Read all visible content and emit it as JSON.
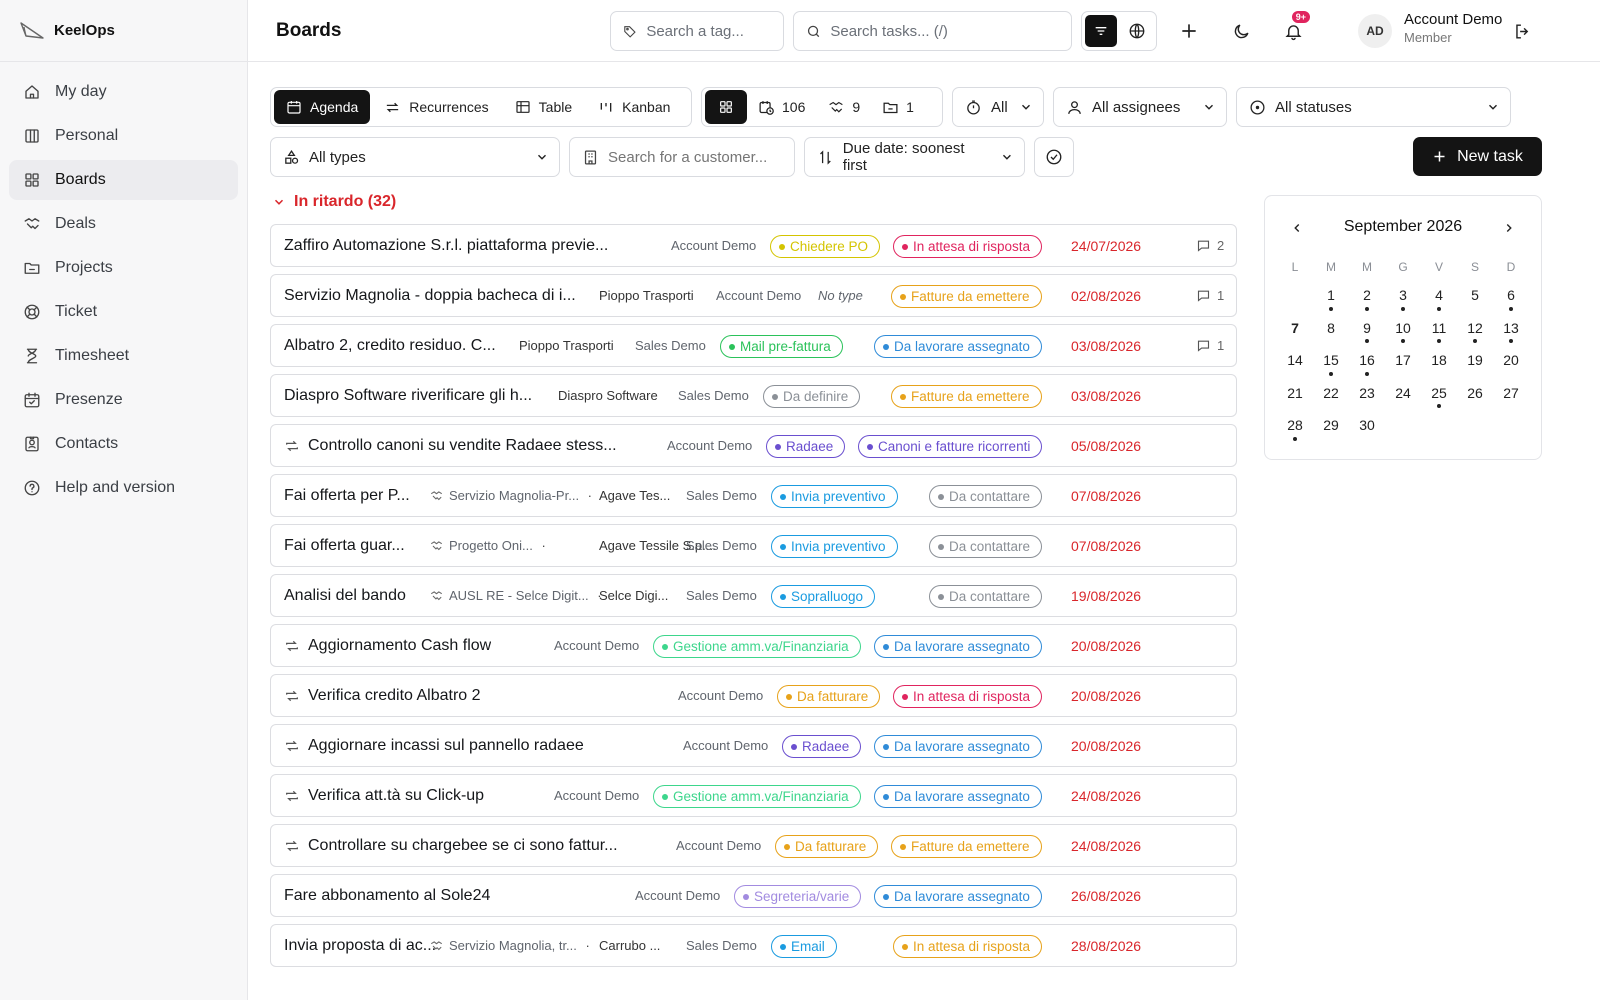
{
  "app": {
    "name": "KeelOps"
  },
  "sidebar": {
    "items": [
      {
        "label": "My day",
        "icon": "home-icon"
      },
      {
        "label": "Personal",
        "icon": "board-icon"
      },
      {
        "label": "Boards",
        "icon": "grid-icon",
        "active": true
      },
      {
        "label": "Deals",
        "icon": "handshake-icon"
      },
      {
        "label": "Projects",
        "icon": "folder-icon"
      },
      {
        "label": "Ticket",
        "icon": "lifebuoy-icon"
      },
      {
        "label": "Timesheet",
        "icon": "hourglass-icon"
      },
      {
        "label": "Presenze",
        "icon": "calendar-check-icon"
      },
      {
        "label": "Contacts",
        "icon": "contact-card-icon"
      },
      {
        "label": "Help and version",
        "icon": "help-circle-icon"
      }
    ]
  },
  "header": {
    "title": "Boards",
    "tag_search_placeholder": "Search a tag...",
    "task_search_placeholder": "Search tasks... (/)",
    "notif_badge": "9+",
    "avatar_initials": "AD",
    "user_name": "Account Demo",
    "user_role": "Member"
  },
  "toolbar": {
    "views": [
      "Agenda",
      "Recurrences",
      "Table",
      "Kanban"
    ],
    "active_view": "Agenda",
    "counts": {
      "tasks": "106",
      "projects": "9",
      "folders": "1"
    },
    "time_filter": "All",
    "assignees_filter": "All assignees",
    "status_filter": "All statuses",
    "types_filter": "All types",
    "customer_search_placeholder": "Search for a customer...",
    "sort": "Due date: soonest first",
    "new_task": "New task"
  },
  "section": {
    "title": "In ritardo (32)"
  },
  "colors": {
    "yellow": "#d4c400",
    "pink": "#e0245e",
    "orange": "#e7a21a",
    "green": "#2bc25a",
    "blue": "#2f8bd8",
    "gray": "#8b9097",
    "purple": "#6a4fcf",
    "mint": "#3dd68c",
    "lavender": "#a28be0",
    "sky": "#1a9be0",
    "red": "#d9262b"
  },
  "tasks": [
    {
      "title": "Zaffiro Automazione S.r.l. piattaforma previe...",
      "recurring": false,
      "account": "Account Demo",
      "tag": {
        "label": "Chiedere PO",
        "color": "yellow"
      },
      "status": {
        "label": "In attesa di risposta",
        "color": "pink"
      },
      "date": "24/07/2026",
      "comments": "2"
    },
    {
      "title": "Servizio Magnolia - doppia bacheca di i...",
      "recurring": false,
      "customer": "Pioppo Trasporti",
      "account": "Account Demo",
      "type": "No type",
      "status": {
        "label": "Fatture da emettere",
        "color": "orange"
      },
      "date": "02/08/2026",
      "comments": "1"
    },
    {
      "title": "Albatro 2, credito residuo. C...",
      "recurring": false,
      "customer": "Pioppo Trasporti",
      "account": "Sales Demo",
      "tag": {
        "label": "Mail pre-fattura",
        "color": "green"
      },
      "status": {
        "label": "Da lavorare assegnato",
        "color": "blue"
      },
      "date": "03/08/2026",
      "comments": "1"
    },
    {
      "title": "Diaspro Software riverificare gli h...",
      "recurring": false,
      "customer": "Diaspro Software",
      "account": "Sales Demo",
      "tag": {
        "label": "Da definire",
        "color": "gray"
      },
      "status": {
        "label": "Fatture da emettere",
        "color": "orange"
      },
      "date": "03/08/2026"
    },
    {
      "title": "Controllo canoni su vendite Radaee stess...",
      "recurring": true,
      "account": "Account Demo",
      "tag": {
        "label": "Radaee",
        "color": "purple"
      },
      "status": {
        "label": "Canoni e fatture ricorrenti",
        "color": "purple"
      },
      "date": "05/08/2026"
    },
    {
      "title": "Fai offerta per P...",
      "recurring": false,
      "project": "Servizio Magnolia-Pr...",
      "customer": "Agave Tes...",
      "account": "Sales Demo",
      "tag": {
        "label": "Invia preventivo",
        "color": "sky"
      },
      "status": {
        "label": "Da contattare",
        "color": "gray"
      },
      "date": "07/08/2026"
    },
    {
      "title": "Fai offerta guar...",
      "recurring": false,
      "project": "Progetto Oni...",
      "customer": "Agave Tessile S.p....",
      "account": "Sales Demo",
      "tag": {
        "label": "Invia preventivo",
        "color": "sky"
      },
      "status": {
        "label": "Da contattare",
        "color": "gray"
      },
      "date": "07/08/2026"
    },
    {
      "title": "Analisi del bando",
      "recurring": false,
      "project": "AUSL RE - Selce Digit...",
      "customer": "Selce Digi...",
      "account": "Sales Demo",
      "tag": {
        "label": "Sopralluogo",
        "color": "sky"
      },
      "status": {
        "label": "Da contattare",
        "color": "gray"
      },
      "date": "19/08/2026"
    },
    {
      "title": "Aggiornamento Cash flow",
      "recurring": true,
      "account": "Account Demo",
      "tag": {
        "label": "Gestione amm.va/Finanziaria",
        "color": "mint"
      },
      "status": {
        "label": "Da lavorare assegnato",
        "color": "blue"
      },
      "date": "20/08/2026"
    },
    {
      "title": "Verifica credito Albatro 2",
      "recurring": true,
      "account": "Account Demo",
      "tag": {
        "label": "Da fatturare",
        "color": "orange"
      },
      "status": {
        "label": "In attesa di risposta",
        "color": "pink"
      },
      "date": "20/08/2026"
    },
    {
      "title": "Aggiornare incassi sul pannello radaee",
      "recurring": true,
      "account": "Account Demo",
      "tag": {
        "label": "Radaee",
        "color": "purple"
      },
      "status": {
        "label": "Da lavorare assegnato",
        "color": "blue"
      },
      "date": "20/08/2026"
    },
    {
      "title": "Verifica att.tà su Click-up",
      "recurring": true,
      "account": "Account Demo",
      "tag": {
        "label": "Gestione amm.va/Finanziaria",
        "color": "mint"
      },
      "status": {
        "label": "Da lavorare assegnato",
        "color": "blue"
      },
      "date": "24/08/2026"
    },
    {
      "title": "Controllare su chargebee se ci sono fattur...",
      "recurring": true,
      "account": "Account Demo",
      "tag": {
        "label": "Da fatturare",
        "color": "orange"
      },
      "status": {
        "label": "Fatture da emettere",
        "color": "orange"
      },
      "date": "24/08/2026"
    },
    {
      "title": "Fare abbonamento al Sole24",
      "recurring": false,
      "account": "Account Demo",
      "tag": {
        "label": "Segreteria/varie",
        "color": "lavender"
      },
      "status": {
        "label": "Da lavorare assegnato",
        "color": "blue"
      },
      "date": "26/08/2026"
    },
    {
      "title": "Invia proposta di ac...",
      "recurring": false,
      "project": "Servizio Magnolia, tr...",
      "customer": "Carrubo ...",
      "account": "Sales Demo",
      "tag": {
        "label": "Email",
        "color": "sky"
      },
      "status": {
        "label": "In attesa di risposta",
        "color": "orange"
      },
      "date": "28/08/2026"
    }
  ],
  "calendar": {
    "month": "September 2026",
    "weekdays": [
      "L",
      "M",
      "M",
      "G",
      "V",
      "S",
      "D"
    ],
    "first_weekday_offset": 1,
    "days_in_month": 30,
    "today": 7,
    "days_with_tasks": [
      1,
      2,
      3,
      4,
      6,
      9,
      10,
      11,
      12,
      13,
      15,
      16,
      25,
      28
    ]
  }
}
